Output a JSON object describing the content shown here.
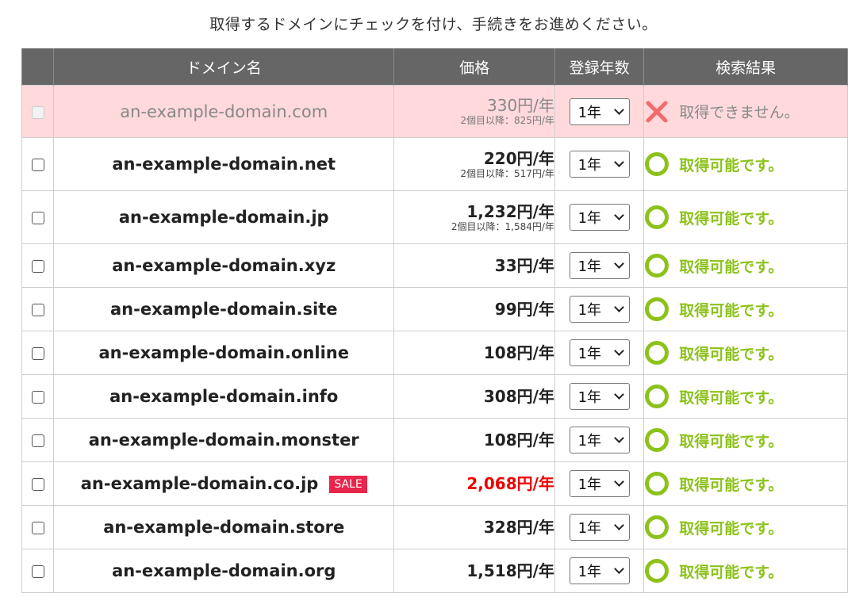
{
  "instruction": "取得するドメインにチェックを付け、手続きをお進めください。",
  "headers": {
    "name": "ドメイン名",
    "price": "価格",
    "years": "登録年数",
    "result": "検索結果"
  },
  "rows": [
    {
      "domain": "an-example-domain.com",
      "price": "330円/年",
      "renewal": "2個目以降：825円/年",
      "years": "1年",
      "result": "取得できません。",
      "available": false,
      "sale": false
    },
    {
      "domain": "an-example-domain.net",
      "price": "220円/年",
      "renewal": "2個目以降：517円/年",
      "years": "1年",
      "result": "取得可能です。",
      "available": true,
      "sale": false
    },
    {
      "domain": "an-example-domain.jp",
      "price": "1,232円/年",
      "renewal": "2個目以降：1,584円/年",
      "years": "1年",
      "result": "取得可能です。",
      "available": true,
      "sale": false
    },
    {
      "domain": "an-example-domain.xyz",
      "price": "33円/年",
      "renewal": "",
      "years": "1年",
      "result": "取得可能です。",
      "available": true,
      "sale": false
    },
    {
      "domain": "an-example-domain.site",
      "price": "99円/年",
      "renewal": "",
      "years": "1年",
      "result": "取得可能です。",
      "available": true,
      "sale": false
    },
    {
      "domain": "an-example-domain.online",
      "price": "108円/年",
      "renewal": "",
      "years": "1年",
      "result": "取得可能です。",
      "available": true,
      "sale": false
    },
    {
      "domain": "an-example-domain.info",
      "price": "308円/年",
      "renewal": "",
      "years": "1年",
      "result": "取得可能です。",
      "available": true,
      "sale": false
    },
    {
      "domain": "an-example-domain.monster",
      "price": "108円/年",
      "renewal": "",
      "years": "1年",
      "result": "取得可能です。",
      "available": true,
      "sale": false
    },
    {
      "domain": "an-example-domain.co.jp",
      "price": "2,068円/年",
      "renewal": "",
      "years": "1年",
      "result": "取得可能です。",
      "available": true,
      "sale": true,
      "sale_label": "SALE"
    },
    {
      "domain": "an-example-domain.store",
      "price": "328円/年",
      "renewal": "",
      "years": "1年",
      "result": "取得可能です。",
      "available": true,
      "sale": false
    },
    {
      "domain": "an-example-domain.org",
      "price": "1,518円/年",
      "renewal": "",
      "years": "1年",
      "result": "取得可能です。",
      "available": true,
      "sale": false
    }
  ],
  "colors": {
    "header_bg": "#666666",
    "unavailable_row_bg": "#ffd9dc",
    "available_text": "#8cc21a",
    "unavailable_icon": "#f26b6b",
    "sale_price": "#ee0000",
    "sale_badge": "#e8254a"
  },
  "icons": {
    "available": "circle-ok-icon",
    "unavailable": "cross-icon",
    "select": "chevron-down-icon"
  }
}
